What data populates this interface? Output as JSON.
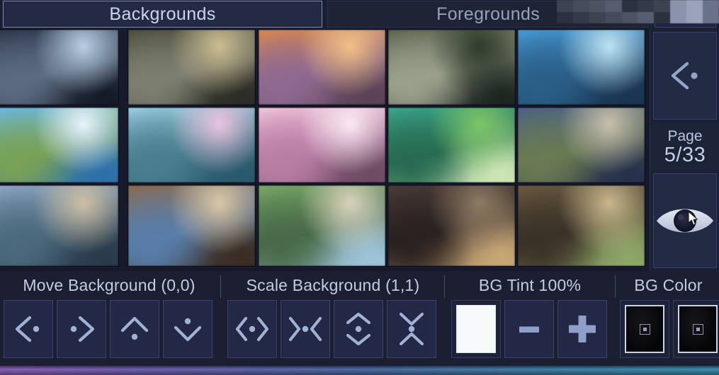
{
  "tabs": [
    {
      "id": "backgrounds",
      "label": "Backgrounds",
      "selected": true
    },
    {
      "id": "foregrounds",
      "label": "Foregrounds",
      "selected": false
    }
  ],
  "sidebar": {
    "prev_icon": "chevron-left-dot-icon",
    "page_label": "Page",
    "page_value": "5/33",
    "page_current": 5,
    "page_total": 33,
    "eye_icon": "eye-icon"
  },
  "gallery": {
    "columns": 5,
    "rows": 3,
    "thumbnails": [
      {
        "id": "bg-r1c1",
        "alt": "rainy-alley-street",
        "colors": [
          "#2a3346",
          "#b9cfe3",
          "#5d6b80",
          "#141a26"
        ]
      },
      {
        "id": "bg-r1c2",
        "alt": "japanese-school-hallway",
        "colors": [
          "#4a4b3e",
          "#cbbd94",
          "#7d7f72",
          "#2a2c25"
        ]
      },
      {
        "id": "bg-r1c3",
        "alt": "sunset-town-street",
        "colors": [
          "#d98a4e",
          "#f0c08a",
          "#8e6a8f",
          "#5a4256"
        ]
      },
      {
        "id": "bg-r1c4",
        "alt": "shrine-torii-steps",
        "colors": [
          "#5a6150",
          "#2f3a2c",
          "#9aa08c",
          "#1c2420"
        ]
      },
      {
        "id": "bg-r1c5",
        "alt": "classroom-window-view",
        "colors": [
          "#4a9bd4",
          "#bfe3f2",
          "#2d5f86",
          "#1b3550"
        ]
      },
      {
        "id": "bg-r2c1",
        "alt": "grass-field-clouds",
        "colors": [
          "#6db8e8",
          "#e8f4fb",
          "#7aa05a",
          "#2f6fa8"
        ]
      },
      {
        "id": "bg-r2c2",
        "alt": "sakura-shrine-lake",
        "colors": [
          "#9fd2e4",
          "#e8c3dd",
          "#4b7f8e",
          "#2b5a6b"
        ]
      },
      {
        "id": "bg-r2c3",
        "alt": "cherry-blossom-torii",
        "colors": [
          "#f0c8dd",
          "#fbe9f2",
          "#b77fa3",
          "#6d4a62"
        ]
      },
      {
        "id": "bg-r2c4",
        "alt": "green-hill-meadow",
        "colors": [
          "#3fa98f",
          "#7ec46a",
          "#2a6a52",
          "#cfe6b8"
        ]
      },
      {
        "id": "bg-r2c5",
        "alt": "suburban-alley-daytime",
        "colors": [
          "#4a5f86",
          "#c8c0ad",
          "#6a7a55",
          "#26304a"
        ]
      },
      {
        "id": "bg-r3c1",
        "alt": "countryside-road-houses",
        "colors": [
          "#8fa8c4",
          "#cdbfa6",
          "#4d6a7d",
          "#2a3a4a"
        ]
      },
      {
        "id": "bg-r3c2",
        "alt": "living-room-interior",
        "colors": [
          "#8a6a4e",
          "#d9c7a8",
          "#5a7ea8",
          "#3a2c22"
        ]
      },
      {
        "id": "bg-r3c3",
        "alt": "plant-filled-room",
        "colors": [
          "#7aa86a",
          "#d8d2bc",
          "#4a6a4a",
          "#9fc4d8"
        ]
      },
      {
        "id": "bg-r3c4",
        "alt": "dark-lounge-sofa",
        "colors": [
          "#4a3c38",
          "#8c7a64",
          "#2a2220",
          "#c8a878"
        ]
      },
      {
        "id": "bg-r3c5",
        "alt": "japanese-room-tatami",
        "colors": [
          "#6a5a44",
          "#c8b68e",
          "#3a3228",
          "#8fa86a"
        ]
      }
    ]
  },
  "toolbar": {
    "sections": [
      {
        "id": "move-background",
        "title": "Move Background (0,0)",
        "value": "(0,0)",
        "buttons": [
          {
            "id": "move-left",
            "icon": "chevron-left-dot-icon"
          },
          {
            "id": "move-right",
            "icon": "chevron-right-dot-icon"
          },
          {
            "id": "move-up",
            "icon": "chevron-up-dot-icon"
          },
          {
            "id": "move-down",
            "icon": "chevron-down-dot-icon"
          }
        ]
      },
      {
        "id": "scale-background",
        "title": "Scale Background (1,1)",
        "value": "(1,1)",
        "buttons": [
          {
            "id": "scale-width-increase",
            "icon": "expand-horizontal-icon"
          },
          {
            "id": "scale-width-decrease",
            "icon": "contract-horizontal-icon"
          },
          {
            "id": "scale-height-increase",
            "icon": "expand-vertical-icon"
          },
          {
            "id": "scale-height-decrease",
            "icon": "contract-vertical-icon"
          }
        ]
      },
      {
        "id": "bg-tint",
        "title": "BG Tint 100%",
        "value": "100%",
        "buttons": [
          {
            "id": "tint-swatch",
            "icon": "white-swatch",
            "color": "#ffffff"
          },
          {
            "id": "tint-decrease",
            "icon": "minus-icon"
          },
          {
            "id": "tint-increase",
            "icon": "plus-icon"
          }
        ]
      },
      {
        "id": "bg-color",
        "title": "BG Color",
        "value": "",
        "buttons": [
          {
            "id": "bg-color-swatch-1",
            "icon": "dark-swatch",
            "color": "#000000"
          },
          {
            "id": "bg-color-swatch-2",
            "icon": "dark-swatch",
            "color": "#000000"
          }
        ]
      }
    ]
  },
  "theme": {
    "accent": "#8fa0c8",
    "panel_bg": "#1b1f31",
    "button_bg": "#222845",
    "button_border": "#3a4268",
    "text": "#c2cde5",
    "gradient_left": "#7a4fa8",
    "gradient_right": "#2b7f9e"
  }
}
